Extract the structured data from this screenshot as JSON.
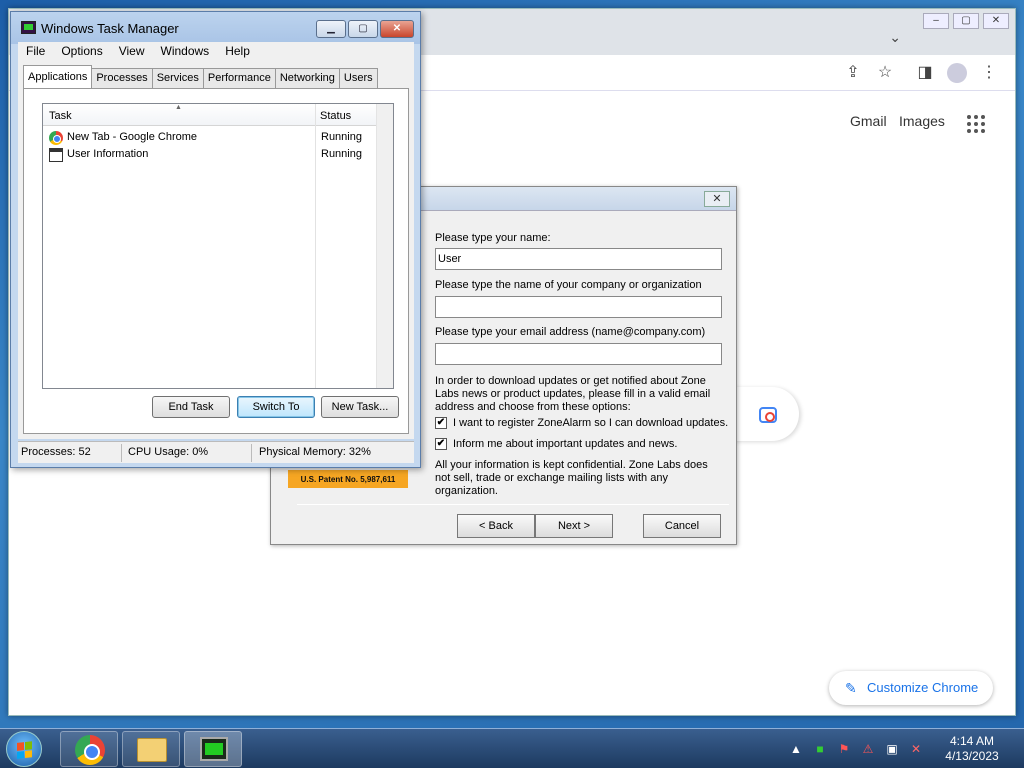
{
  "chrome": {
    "window_controls": {
      "minimize": "–",
      "maximize": "▢",
      "close": "✕"
    },
    "tab_dropdown": "⌄",
    "links": {
      "gmail": "Gmail",
      "images": "Images"
    },
    "customize": "Customize Chrome"
  },
  "zonealarm": {
    "close": "✕",
    "name_label": "Please type your name:",
    "name_value": "User",
    "company_label": "Please type the name of your company or organization",
    "company_value": "",
    "email_label": "Please type your email address (name@company.com)",
    "email_value": "",
    "info_text": "In order to download updates or get notified about Zone Labs news or product updates, please fill in a valid email address and choose from these options:",
    "checkbox1": {
      "label": "I want to register ZoneAlarm so I can download updates.",
      "checked": "✔"
    },
    "checkbox2": {
      "label": "Inform me about important updates and news.",
      "checked": "✔"
    },
    "privacy_text": "All your information is kept confidential. Zone Labs does not sell, trade or exchange mailing lists with any organization.",
    "patent": "U.S. Patent No. 5,987,611",
    "buttons": {
      "back": "< Back",
      "next": "Next >",
      "cancel": "Cancel"
    }
  },
  "taskmgr": {
    "title": "Windows Task Manager",
    "controls": {
      "minimize": "▁",
      "maximize": "▢",
      "close": "✕"
    },
    "menu": [
      "File",
      "Options",
      "View",
      "Windows",
      "Help"
    ],
    "tabs": [
      "Applications",
      "Processes",
      "Services",
      "Performance",
      "Networking",
      "Users"
    ],
    "columns": {
      "task": "Task",
      "status": "Status"
    },
    "rows": [
      {
        "name": "New Tab - Google Chrome",
        "status": "Running"
      },
      {
        "name": "User Information",
        "status": "Running"
      }
    ],
    "buttons": {
      "end_task": "End Task",
      "switch_to": "Switch To",
      "new_task": "New Task..."
    },
    "status": {
      "processes": "Processes: 52",
      "cpu": "CPU Usage: 0%",
      "memory": "Physical Memory: 32%"
    }
  },
  "taskbar": {
    "clock_time": "4:14 AM",
    "clock_date": "4/13/2023",
    "tray_arrow": "▲"
  }
}
